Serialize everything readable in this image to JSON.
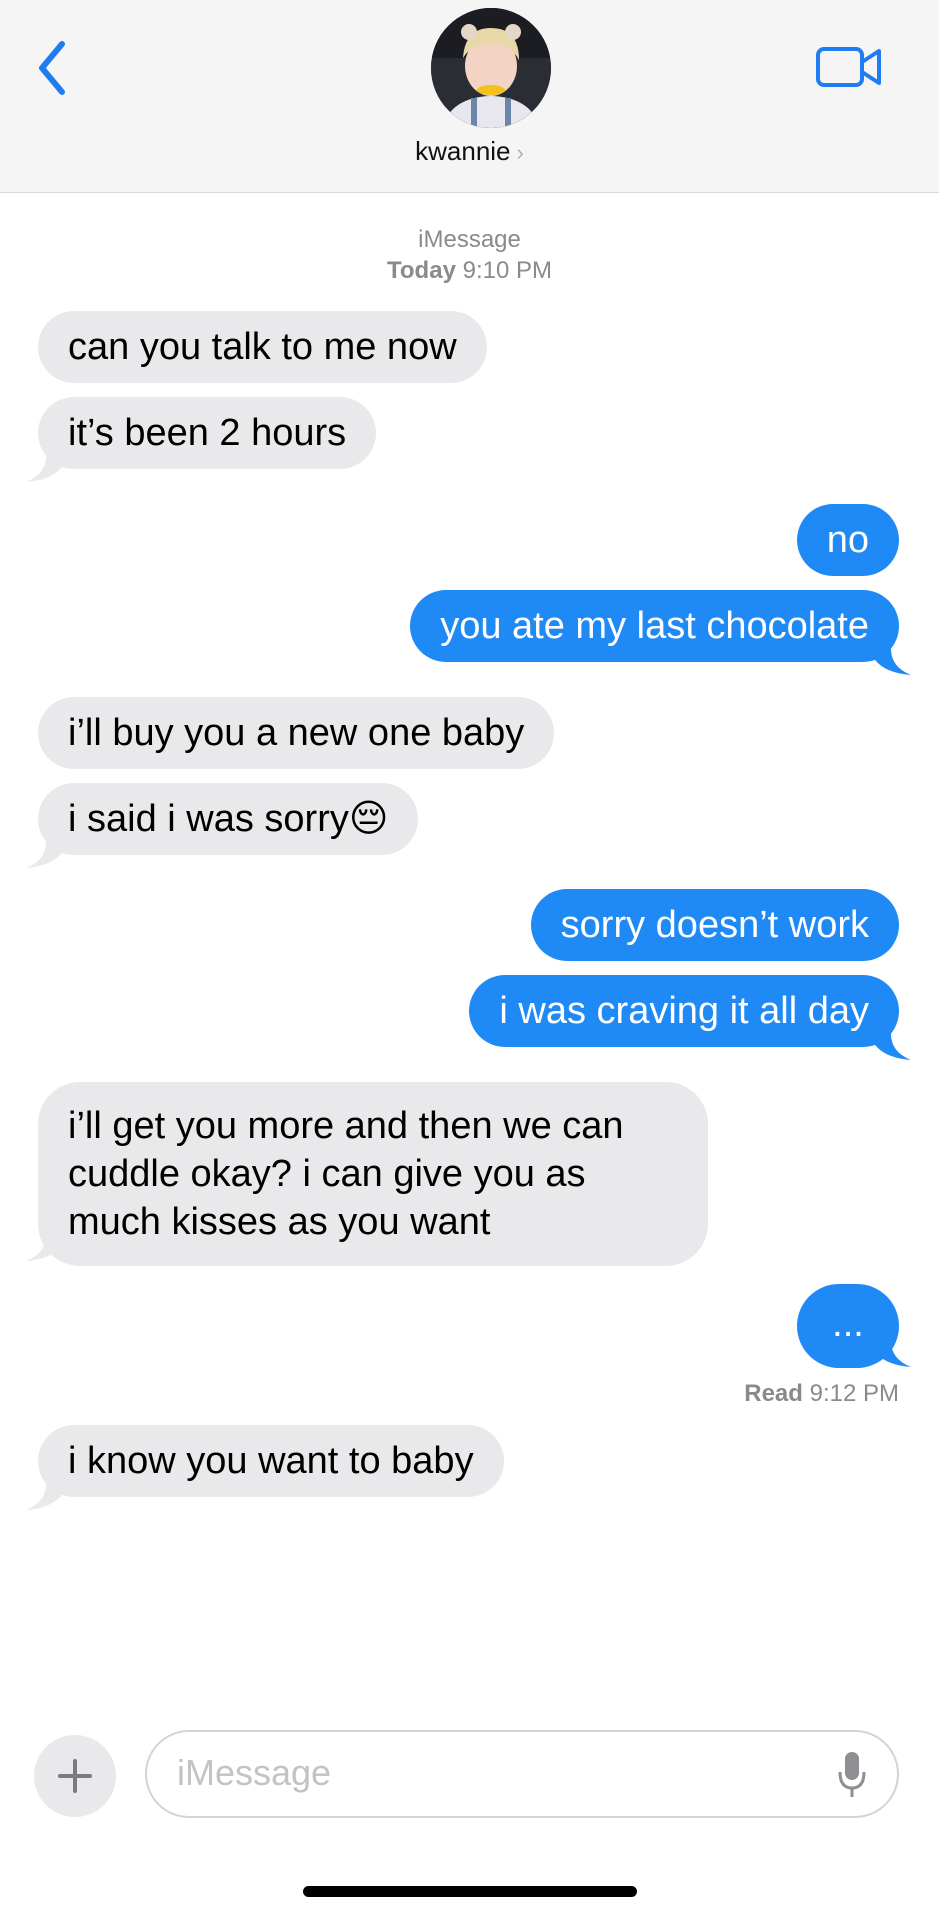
{
  "header": {
    "contact_name": "kwannie",
    "contact_chevron": "›",
    "back_icon": "chevron-left",
    "video_icon": "video-camera",
    "accent": "#1f7cf1"
  },
  "thread": {
    "service": "iMessage",
    "date_day": "Today",
    "date_time": "9:10 PM",
    "messages": [
      {
        "from": "them",
        "text": "can you talk to me now"
      },
      {
        "from": "them",
        "text": "it’s been 2 hours"
      },
      {
        "from": "me",
        "text": "no"
      },
      {
        "from": "me",
        "text": "you ate my last chocolate"
      },
      {
        "from": "them",
        "text": "i’ll buy you a new one baby"
      },
      {
        "from": "them",
        "text": "i said i was sorry😔"
      },
      {
        "from": "me",
        "text": "sorry doesn’t work"
      },
      {
        "from": "me",
        "text": "i was craving it all day"
      },
      {
        "from": "them",
        "text": "i’ll get you more and then we can cuddle okay? i can give you as much kisses as you want"
      },
      {
        "from": "me",
        "text": "..."
      },
      {
        "from": "them",
        "text": "i know you want to baby"
      }
    ],
    "read_label": "Read",
    "read_time": "9:12 PM"
  },
  "composer": {
    "placeholder": "iMessage",
    "plus_icon": "plus",
    "mic_icon": "microphone"
  },
  "colors": {
    "incoming_bubble": "#e9e9eb",
    "outgoing_bubble": "#1f8af5"
  }
}
